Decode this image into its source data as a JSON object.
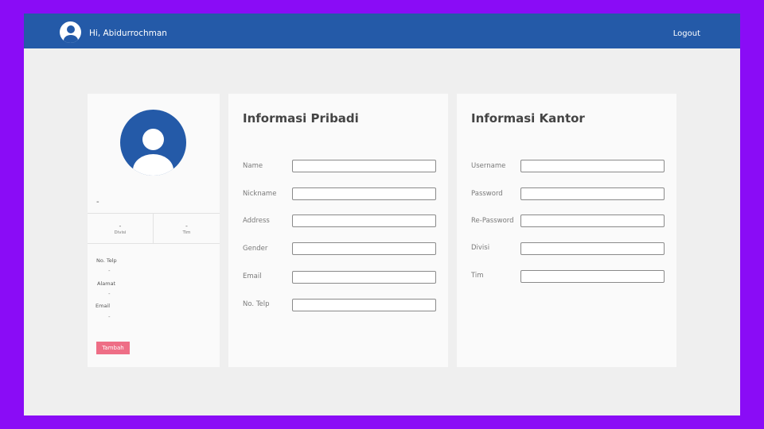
{
  "navbar": {
    "greeting": "Hi, Abidurrochman",
    "logout_label": "Logout",
    "avatar_icon": "user-avatar-icon"
  },
  "profile": {
    "name": "-",
    "stats": [
      {
        "value": "-",
        "label": "Divisi"
      },
      {
        "value": "-",
        "label": "Tim"
      }
    ],
    "contacts": [
      {
        "label": "No. Telp",
        "value": "-"
      },
      {
        "label": "Alamat",
        "value": "-"
      },
      {
        "label": "Email",
        "value": "-"
      }
    ],
    "add_button_label": "Tambah",
    "add_button_color": "#ee6e86"
  },
  "informasi_pribadi": {
    "title": "Informasi Pribadi",
    "fields": [
      {
        "label": "Name",
        "value": ""
      },
      {
        "label": "Nickname",
        "value": ""
      },
      {
        "label": "Address",
        "value": ""
      },
      {
        "label": "Gender",
        "value": ""
      },
      {
        "label": "Email",
        "value": ""
      },
      {
        "label": "No. Telp",
        "value": ""
      }
    ]
  },
  "informasi_kantor": {
    "title": "Informasi Kantor",
    "fields": [
      {
        "label": "Username",
        "value": ""
      },
      {
        "label": "Password",
        "value": ""
      },
      {
        "label": "Re-Password",
        "value": ""
      },
      {
        "label": "Divisi",
        "value": ""
      },
      {
        "label": "Tim",
        "value": ""
      }
    ]
  },
  "colors": {
    "frame": "#8a0cf6",
    "navbar": "#245aa8",
    "background": "#efefef",
    "card": "#fafafa"
  }
}
